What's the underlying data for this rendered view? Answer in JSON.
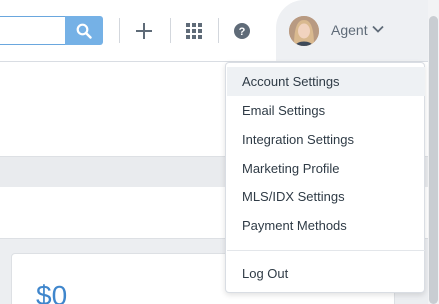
{
  "header": {
    "search": {
      "value": "",
      "placeholder": ""
    },
    "icons": {
      "search": "search-icon",
      "add": "plus-icon",
      "apps": "grid-icon",
      "help": "question-icon"
    },
    "help_glyph": "?",
    "agent": {
      "label": "Agent",
      "dropdown_icon": "chevron-down-icon"
    }
  },
  "menu": {
    "items": [
      {
        "label": "Account Settings",
        "active": true
      },
      {
        "label": "Email Settings"
      },
      {
        "label": "Integration Settings"
      },
      {
        "label": "Marketing Profile"
      },
      {
        "label": "MLS/IDX Settings"
      },
      {
        "label": "Payment Methods"
      }
    ],
    "logout": {
      "label": "Log Out"
    }
  },
  "main": {
    "card": {
      "amount": "$0"
    }
  },
  "colors": {
    "accent": "#75b1e6",
    "amount": "#3f86cc",
    "background": "#eceef1"
  }
}
